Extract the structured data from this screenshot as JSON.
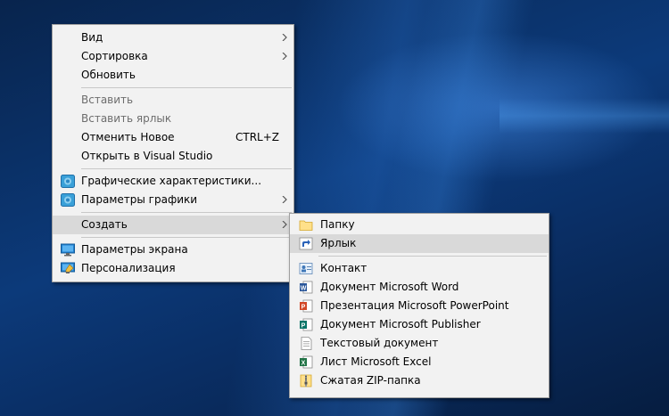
{
  "context_menu": {
    "items": [
      {
        "label": "Вид"
      },
      {
        "label": "Сортировка"
      },
      {
        "label": "Обновить"
      },
      {
        "label": "Вставить"
      },
      {
        "label": "Вставить ярлык"
      },
      {
        "label": "Отменить Новое",
        "shortcut": "CTRL+Z"
      },
      {
        "label": "Открыть в Visual Studio"
      },
      {
        "label": "Графические характеристики...",
        "icon": "intel-graphics-icon"
      },
      {
        "label": "Параметры графики",
        "icon": "intel-graphics-icon"
      },
      {
        "label": "Создать"
      },
      {
        "label": "Параметры экрана",
        "icon": "display-settings-icon"
      },
      {
        "label": "Персонализация",
        "icon": "personalization-icon"
      }
    ]
  },
  "create_submenu": {
    "items": [
      {
        "label": "Папку",
        "icon": "folder-icon"
      },
      {
        "label": "Ярлык",
        "icon": "shortcut-icon"
      },
      {
        "label": "Контакт",
        "icon": "contact-icon"
      },
      {
        "label": "Документ Microsoft Word",
        "icon": "word-icon"
      },
      {
        "label": "Презентация Microsoft PowerPoint",
        "icon": "powerpoint-icon"
      },
      {
        "label": "Документ Microsoft Publisher",
        "icon": "publisher-icon"
      },
      {
        "label": "Текстовый документ",
        "icon": "text-document-icon"
      },
      {
        "label": "Лист Microsoft Excel",
        "icon": "excel-icon"
      },
      {
        "label": "Сжатая ZIP-папка",
        "icon": "zip-folder-icon"
      }
    ]
  },
  "colors": {
    "menu_bg": "#f2f2f2",
    "highlight": "#d9d9d9",
    "disabled_text": "#6d6d6d",
    "desktop_blue": "#0c3a7a"
  }
}
